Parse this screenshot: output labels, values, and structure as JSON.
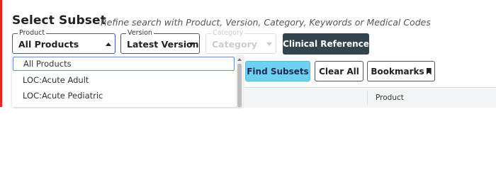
{
  "header": {
    "title": "Select Subset",
    "subtitle": "Refine search with Product, Version, Category, Keywords or Medical Codes"
  },
  "filters": {
    "product": {
      "label": "Product",
      "value": "All Products",
      "icon": "chevron-up-icon"
    },
    "version": {
      "label": "Version",
      "value": "Latest Version",
      "icon": "chevron-down-icon"
    },
    "category": {
      "label": "Category",
      "value": "Category",
      "icon": "chevron-down-icon",
      "disabled": true
    }
  },
  "buttons": {
    "clinical_reference": "Clinical Reference",
    "find_subsets": "Find Subsets",
    "clear_all": "Clear All",
    "bookmarks": "Bookmarks",
    "bookmarks_icon": "bookmark-icon"
  },
  "product_dropdown": {
    "options": [
      "All Products",
      "LOC:Acute Adult",
      "LOC:Acute Pediatric"
    ],
    "selected_index": 0
  },
  "table": {
    "columns": [
      "",
      "Product"
    ]
  },
  "colors": {
    "accent_red": "#e02a2a",
    "clinical_button_bg": "#34444f",
    "find_button_bg": "#6fd0f2",
    "focus_border": "#3a5bbf"
  }
}
